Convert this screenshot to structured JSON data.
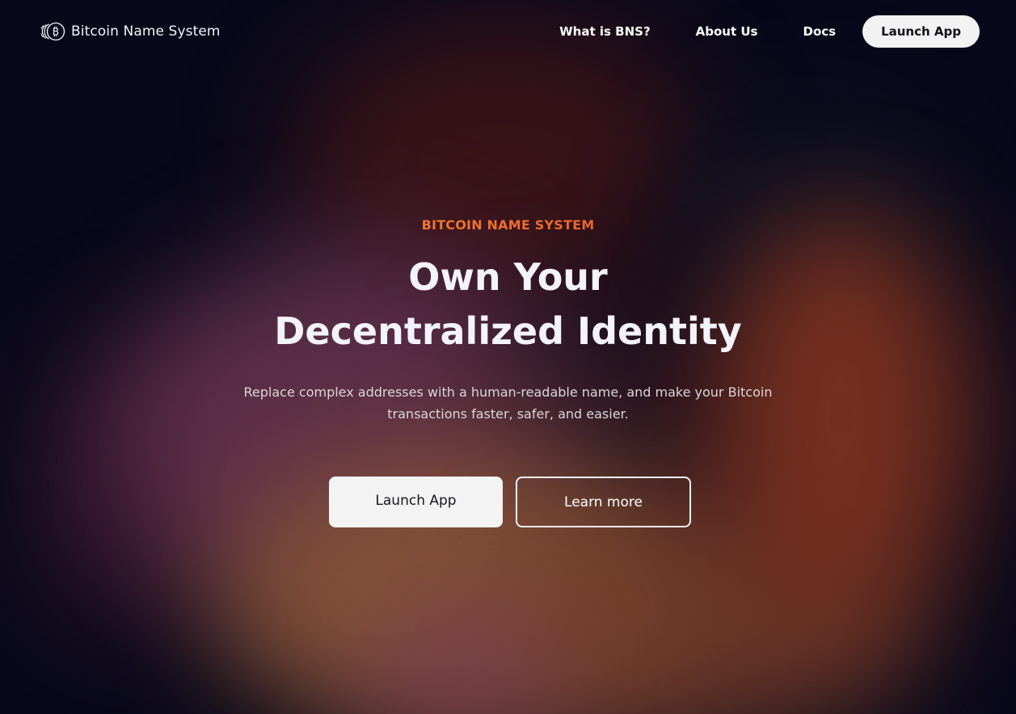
{
  "brand": {
    "name": "Bitcoin Name System",
    "logo_icon": "bitcoin-rings-icon"
  },
  "nav": {
    "links": [
      "What is BNS?",
      "About Us",
      "Docs"
    ],
    "cta_label": "Launch App"
  },
  "hero": {
    "eyebrow": "BITCOIN NAME SYSTEM",
    "headline_line1": "Own Your",
    "headline_line2": "Decentralized Identity",
    "subtext": "Replace complex addresses with a human-readable name, and make your Bitcoin transactions faster, safer, and easier.",
    "primary_button": "Launch App",
    "secondary_button": "Learn more"
  },
  "colors": {
    "background": "#08081a",
    "eyebrow_gradient_start": "#f7a531",
    "eyebrow_gradient_end": "#e8362a",
    "button_light": "#f2f2f2",
    "text_light": "#f3f4fb"
  }
}
